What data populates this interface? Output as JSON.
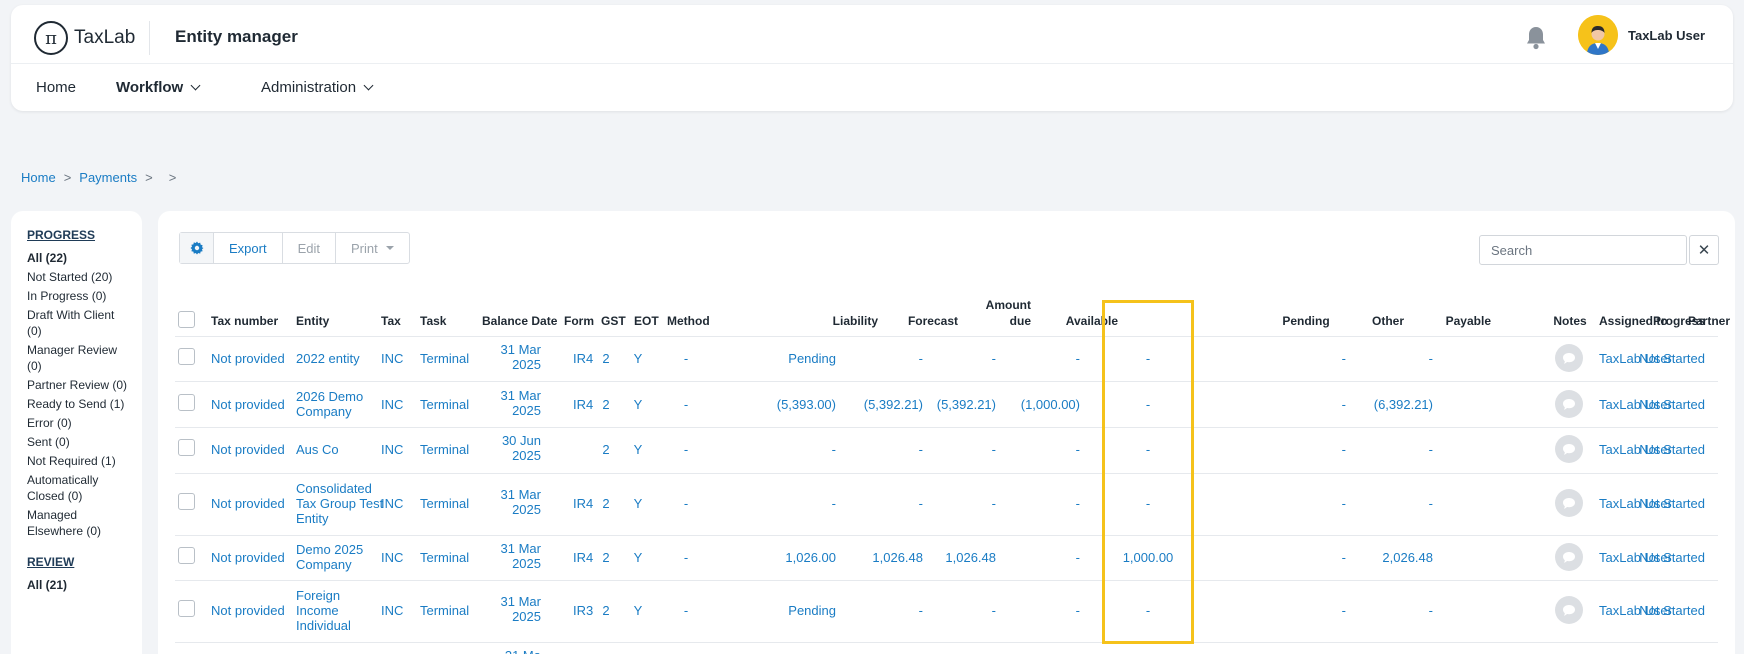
{
  "header": {
    "logo_glyph": "π",
    "logo_text": "TaxLab",
    "app_title": "Entity manager",
    "user_name": "TaxLab User",
    "icons": {
      "notifications": "bell-icon",
      "avatar": "user-avatar"
    }
  },
  "nav": {
    "items": [
      {
        "label": "Home",
        "active": false,
        "dropdown": false
      },
      {
        "label": "Workflow",
        "active": true,
        "dropdown": true
      },
      {
        "label": "Administration",
        "active": false,
        "dropdown": true
      }
    ]
  },
  "breadcrumb": {
    "items": [
      "Home",
      "Payments"
    ],
    "sep": ">"
  },
  "sidebar": {
    "progress_heading": "PROGRESS",
    "progress_items": [
      "All (22)",
      "Not Started (20)",
      "In Progress (0)",
      "Draft With Client (0)",
      "Manager Review (0)",
      "Partner Review (0)",
      "Ready to Send (1)",
      "Error (0)",
      "Sent (0)",
      "Not Required (1)",
      "Automatically Closed (0)",
      "Managed Elsewhere (0)"
    ],
    "review_heading": "REVIEW",
    "review_items": [
      "All (21)"
    ]
  },
  "toolbar": {
    "gear_icon": "gear-icon",
    "export_label": "Export",
    "edit_label": "Edit",
    "print_label": "Print",
    "search_placeholder": "Search",
    "clear_glyph": "✕"
  },
  "table": {
    "columns": {
      "tax_number": "Tax number",
      "entity": "Entity",
      "tax": "Tax",
      "task": "Task",
      "balance_date": "Balance Date",
      "form": "Form",
      "gst": "GST",
      "eot": "EOT",
      "method": "Method",
      "liability": "Liability",
      "forecast": "Forecast",
      "amount_due_1": "Amount",
      "amount_due_2": "due",
      "available": "Available",
      "pending": "Pending",
      "other": "Other",
      "payable": "Payable",
      "notes": "Notes",
      "progress": "Progress",
      "assigned_to": "Assigned to",
      "partner": "Partner"
    },
    "rows": [
      {
        "tax_number": "Not provided",
        "entity": "2022 entity",
        "tax": "INC",
        "task": "Terminal",
        "bd1": "31 Mar",
        "bd2": "2025",
        "form": "IR4",
        "gst": "2",
        "eot": "Y",
        "method": "-",
        "liability": "Pending",
        "forecast": "-",
        "amount_due": "-",
        "available": "-",
        "pending": "-",
        "other": "-",
        "payable": "-",
        "progress": "Not Started",
        "assigned_to": "TaxLab User"
      },
      {
        "tax_number": "Not provided",
        "entity": "2026 Demo Company",
        "tax": "INC",
        "task": "Terminal",
        "bd1": "31 Mar",
        "bd2": "2025",
        "form": "IR4",
        "gst": "2",
        "eot": "Y",
        "method": "-",
        "liability": "(5,393.00)",
        "forecast": "(5,392.21)",
        "amount_due": "(5,392.21)",
        "available": "(1,000.00)",
        "pending": "-",
        "other": "-",
        "payable": "(6,392.21)",
        "progress": "Not Started",
        "assigned_to": "TaxLab User"
      },
      {
        "tax_number": "Not provided",
        "entity": "Aus Co",
        "tax": "INC",
        "task": "Terminal",
        "bd1": "30 Jun",
        "bd2": "2025",
        "form": "",
        "gst": "2",
        "eot": "Y",
        "method": "-",
        "liability": "-",
        "forecast": "-",
        "amount_due": "-",
        "available": "-",
        "pending": "-",
        "other": "-",
        "payable": "-",
        "progress": "Not Started",
        "assigned_to": "TaxLab User"
      },
      {
        "tax_number": "Not provided",
        "entity": "Consolidated Tax Group Test Entity",
        "tax": "INC",
        "task": "Terminal",
        "bd1": "31 Mar",
        "bd2": "2025",
        "form": "IR4",
        "gst": "2",
        "eot": "Y",
        "method": "-",
        "liability": "-",
        "forecast": "-",
        "amount_due": "-",
        "available": "-",
        "pending": "-",
        "other": "-",
        "payable": "-",
        "progress": "Not Started",
        "assigned_to": "TaxLab User"
      },
      {
        "tax_number": "Not provided",
        "entity": "Demo 2025 Company",
        "tax": "INC",
        "task": "Terminal",
        "bd1": "31 Mar",
        "bd2": "2025",
        "form": "IR4",
        "gst": "2",
        "eot": "Y",
        "method": "-",
        "liability": "1,026.00",
        "forecast": "1,026.48",
        "amount_due": "1,026.48",
        "available": "-",
        "pending": "1,000.00",
        "other": "-",
        "payable": "2,026.48",
        "progress": "Not Started",
        "assigned_to": "TaxLab User"
      },
      {
        "tax_number": "Not provided",
        "entity": "Foreign Income Individual",
        "tax": "INC",
        "task": "Terminal",
        "bd1": "31 Mar",
        "bd2": "2025",
        "form": "IR3",
        "gst": "2",
        "eot": "Y",
        "method": "-",
        "liability": "Pending",
        "forecast": "-",
        "amount_due": "-",
        "available": "-",
        "pending": "-",
        "other": "-",
        "payable": "-",
        "progress": "Not Started",
        "assigned_to": "TaxLab User"
      }
    ],
    "partial_row": {
      "bd1": "31 Ma"
    }
  },
  "colors": {
    "link": "#1a7cc4",
    "highlight": "#f5c21b",
    "text": "#1f2933"
  }
}
